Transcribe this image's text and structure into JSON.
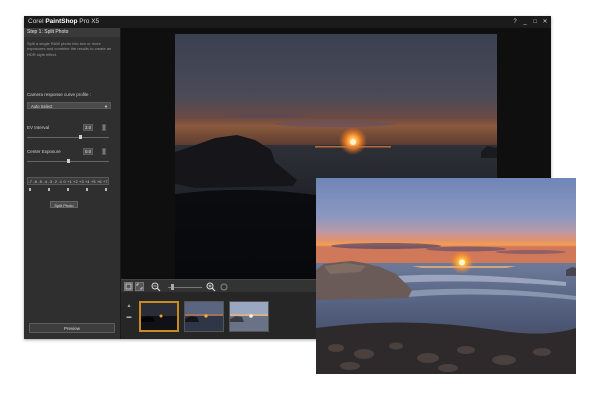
{
  "window": {
    "title_prefix": "Corel ",
    "title_brand": "PaintShop",
    "title_suffix": " Pro X5",
    "controls": [
      "?",
      "_",
      "□",
      "✕"
    ]
  },
  "panel": {
    "step_title": "Step 1: Split Photo",
    "description": "Split a single RAW photo into two or more exposures and combine the results to create an HDR style effect.",
    "profile_label": "Camera response curve profile :",
    "profile_value": "Auto Select",
    "ev_label": "EV Interval",
    "ev_value": "2.0",
    "center_label": "Center Exposure",
    "center_value": "0.0",
    "exposure_scale": "-7  -6  -5  -4  -3  -2  -1  0  +1  +2  +3  +4  +5  +6  +7",
    "split_button": "Split Photo",
    "preview_button": "Preview"
  },
  "toolbar": {
    "icons": [
      "fit-view-icon",
      "actual-size-icon",
      "zoom-out-icon",
      "zoom-in-icon",
      "pan-icon"
    ],
    "zoom_level_fraction": 0.1
  },
  "filmstrip": {
    "thumbnails": [
      "underexposed",
      "normal",
      "overexposed"
    ],
    "selected_index": 0
  },
  "colors": {
    "window_bg": "#2b2b2b",
    "titlebar": "#1b1b1b",
    "selection_accent": "#c98a1f",
    "sunset_orange": "#ff7a18"
  }
}
